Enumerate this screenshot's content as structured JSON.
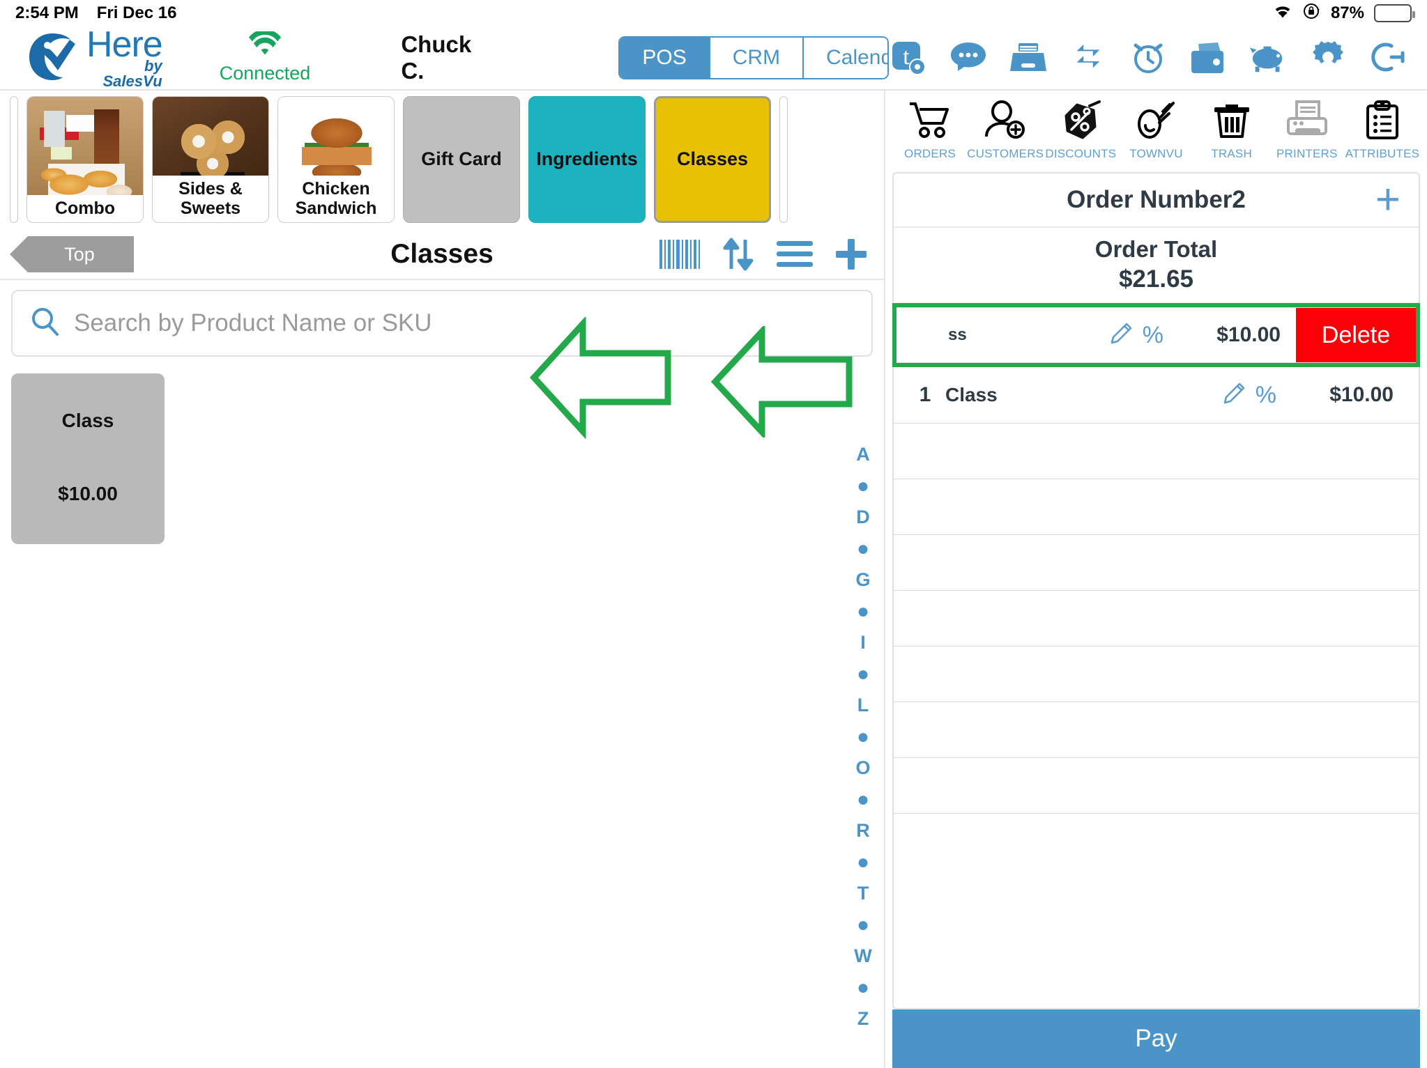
{
  "statusbar": {
    "time": "2:54 PM",
    "date": "Fri Dec 16",
    "battery_pct": "87%",
    "wifi_icon": "wifi-icon",
    "orientation_lock_icon": "rotation-lock-icon",
    "battery_icon": "battery-icon"
  },
  "header": {
    "logo_name": "Here",
    "logo_sub": "by SalesVu",
    "connection_status": "Connected",
    "user_name": "Chuck C.",
    "tabs": [
      {
        "label": "POS",
        "active": true
      },
      {
        "label": "CRM",
        "active": false
      },
      {
        "label": "Calendar",
        "active": false
      }
    ],
    "icons": [
      "townvu-settings-icon",
      "messages-icon",
      "drawer-icon",
      "transfer-icon",
      "alarm-clock-icon",
      "wallet-icon",
      "piggy-bank-icon",
      "gear-icon",
      "logout-icon"
    ]
  },
  "categories": [
    {
      "label": "Combo",
      "type": "photo",
      "photo": "combo-photo"
    },
    {
      "label": "Sides & Sweets",
      "type": "photo",
      "photo": "sides-sweets-photo"
    },
    {
      "label": "Chicken Sandwich",
      "type": "photo",
      "photo": "chicken-sandwich-photo"
    },
    {
      "label": "Gift Card",
      "type": "color",
      "color": "#bfbfbf",
      "selected": false
    },
    {
      "label": "Ingredients",
      "type": "color",
      "color": "#1cb2c0",
      "selected": false
    },
    {
      "label": "Classes",
      "type": "color",
      "color": "#e8c004",
      "selected": true
    }
  ],
  "section": {
    "back_label": "Top",
    "title": "Classes",
    "icons": [
      "barcode-icon",
      "sort-icon",
      "list-icon",
      "plus-icon"
    ]
  },
  "search": {
    "placeholder": "Search by Product Name or SKU",
    "value": "",
    "icon": "search-icon"
  },
  "products": [
    {
      "name": "Class",
      "price": "$10.00"
    }
  ],
  "alpha_index": [
    "A",
    "●",
    "D",
    "●",
    "G",
    "●",
    "I",
    "●",
    "L",
    "●",
    "O",
    "●",
    "R",
    "●",
    "T",
    "●",
    "W",
    "●",
    "Z"
  ],
  "order_toolbar": [
    {
      "label": "ORDERS",
      "icon": "cart-icon"
    },
    {
      "label": "CUSTOMERS",
      "icon": "add-customer-icon"
    },
    {
      "label": "DISCOUNTS",
      "icon": "discount-tag-icon"
    },
    {
      "label": "TOWNVU",
      "icon": "townvu-icon"
    },
    {
      "label": "TRASH",
      "icon": "trash-icon"
    },
    {
      "label": "PRINTERS",
      "icon": "printer-icon"
    },
    {
      "label": "ATTRIBUTES",
      "icon": "clipboard-icon"
    }
  ],
  "order": {
    "number_label": "Order Number2",
    "add_icon": "plus-icon",
    "total_label": "Order Total",
    "total_value": "$21.65",
    "highlighted_row": {
      "qty": "",
      "name": "ss",
      "price": "$10.00",
      "delete_label": "Delete",
      "edit_icon": "pencil-icon",
      "discount_icon": "percent-icon"
    },
    "rows": [
      {
        "qty": "1",
        "name": "Class",
        "price": "$10.00",
        "edit_icon": "pencil-icon",
        "discount_icon": "percent-icon"
      }
    ],
    "empty_rows": 8,
    "pay_label": "Pay"
  },
  "annotations": {
    "arrow_color": "#23a84a",
    "arrows": [
      "left-arrow-annotation-1",
      "left-arrow-annotation-2"
    ],
    "highlight_color": "#23a84a"
  }
}
